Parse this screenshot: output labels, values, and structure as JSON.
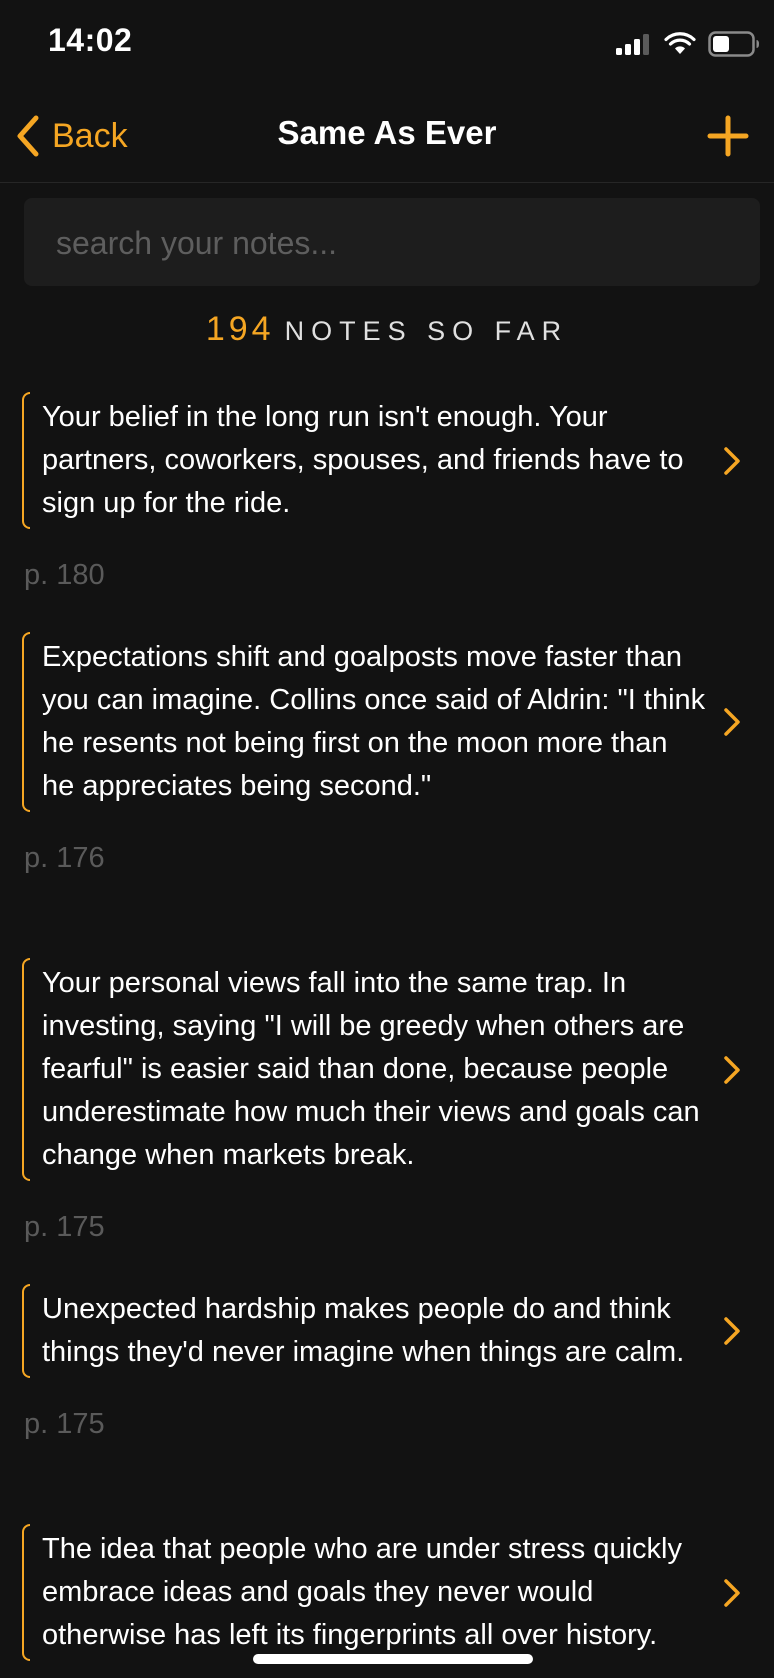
{
  "status_bar": {
    "time": "14:02",
    "icons": [
      "cellular-signal-icon",
      "wifi-icon",
      "battery-icon"
    ]
  },
  "nav": {
    "back_label": "Back",
    "title": "Same As Ever",
    "add_icon": "plus-icon"
  },
  "search": {
    "placeholder": "search your notes..."
  },
  "notes_count": {
    "number": "194",
    "label": "NOTES SO FAR"
  },
  "notes": [
    {
      "text": "Your belief in the long run isn't enough. Your partners, coworkers, spouses, and friends have to sign up for the ride.",
      "page": "p. 180"
    },
    {
      "text": "Expectations shift and goalposts move faster than you can imagine. Collins once said of Aldrin: \"I think he resents not being first on the moon more than he appreciates being second.\"",
      "page": "p. 176"
    },
    {
      "text": "Your personal views fall into the same trap. In investing, saying \"I will be greedy when others are fearful\" is easier said than done, because people underestimate how much their views and goals can change when markets break.",
      "page": "p. 175"
    },
    {
      "text": "Unexpected hardship makes people do and think things they'd never imagine when things are calm.",
      "page": "p. 175"
    },
    {
      "text": "The idea that people who are under stress quickly embrace ideas and goals they never would otherwise has left its fingerprints all over history.",
      "page": ""
    }
  ],
  "colors": {
    "accent": "#f5a623",
    "background": "#121212",
    "search_background": "#1d1d1d",
    "page_text": "#5a5a5a"
  }
}
